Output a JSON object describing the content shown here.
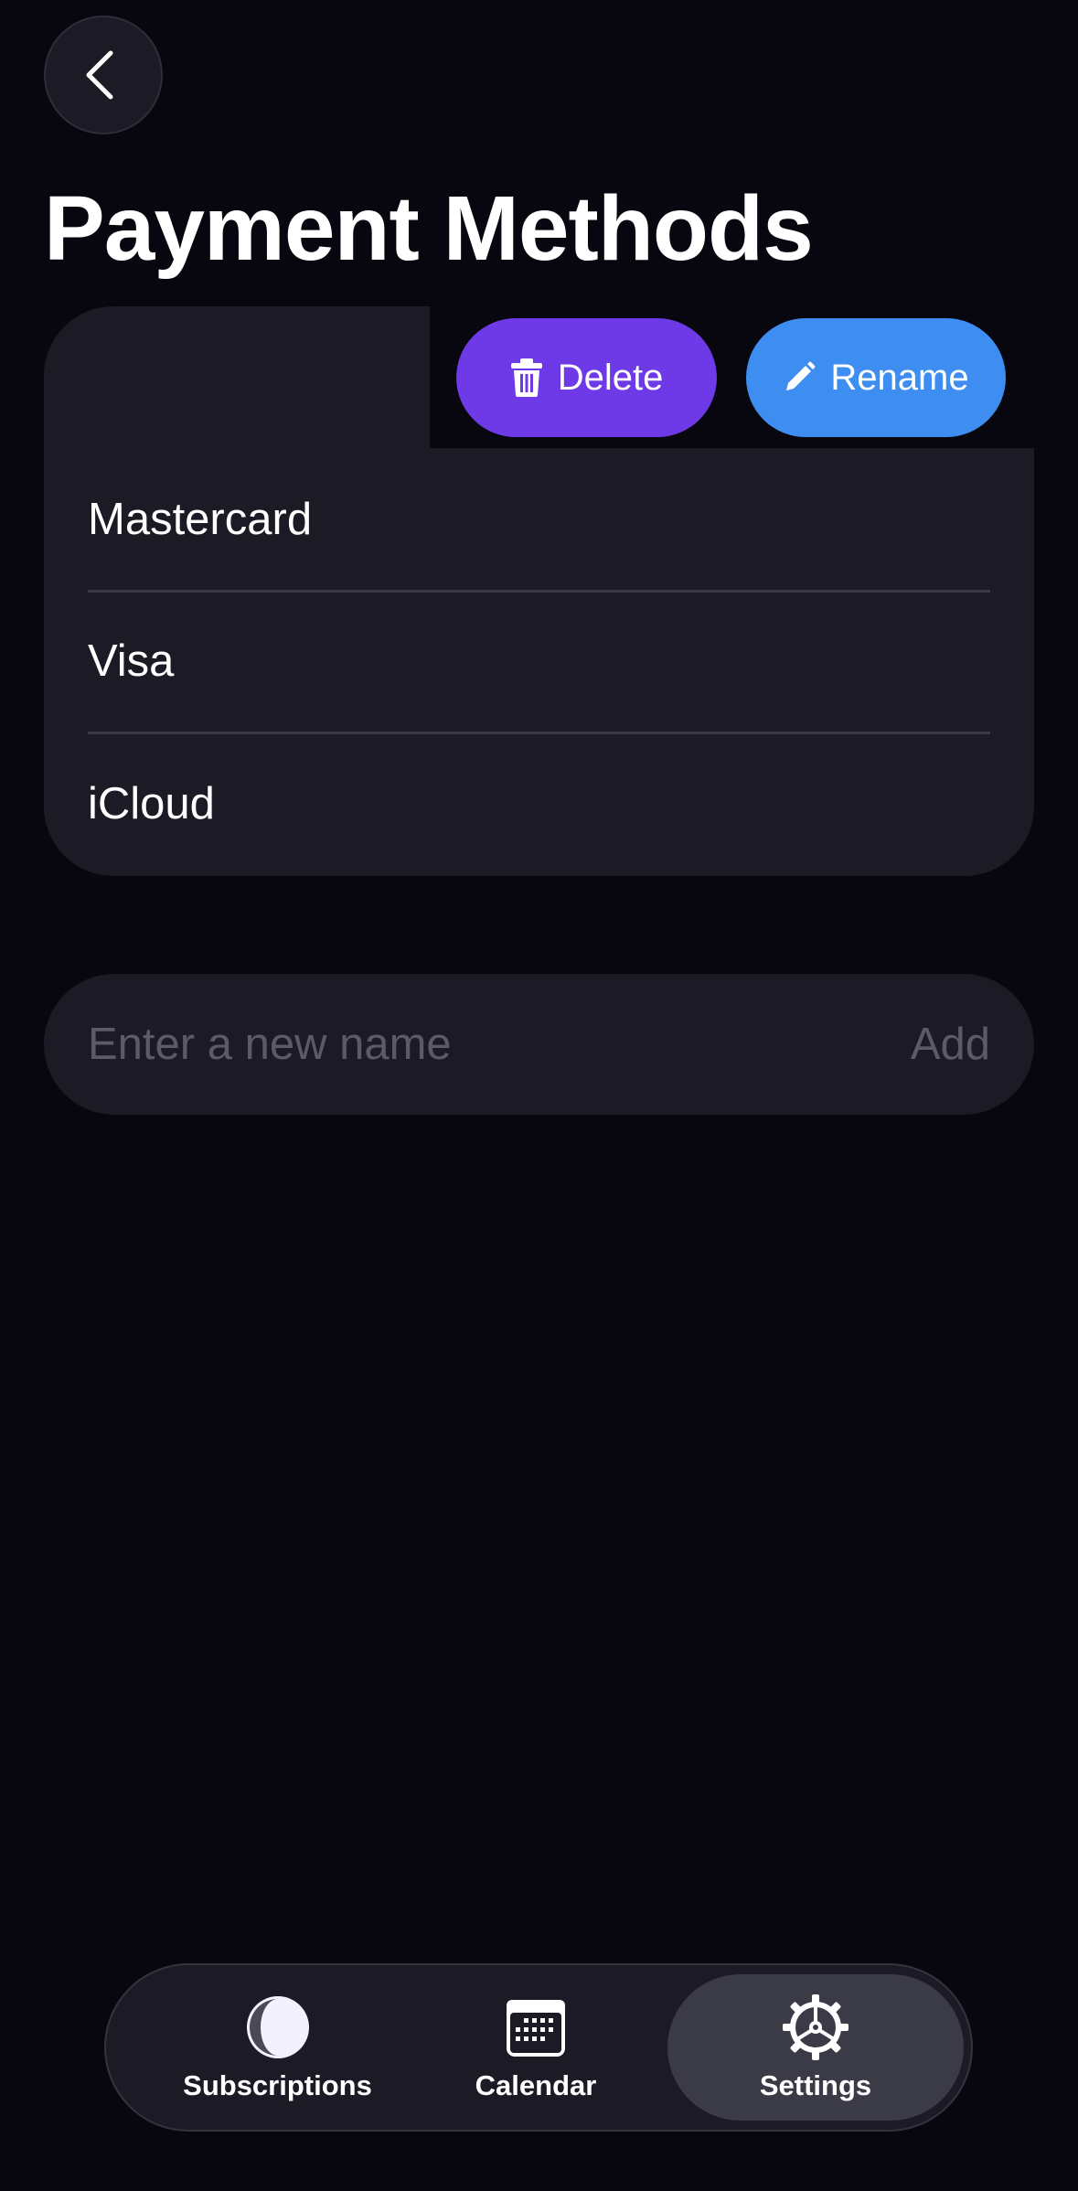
{
  "header": {
    "back_icon": "chevron-left-icon",
    "title": "Payment Methods"
  },
  "row_actions": {
    "delete_label": "Delete",
    "delete_icon": "trash-icon",
    "delete_color": "#6e3ae8",
    "rename_label": "Rename",
    "rename_icon": "pencil-icon",
    "rename_color": "#3d8ef0"
  },
  "payment_methods": [
    {
      "label": "Mastercard"
    },
    {
      "label": "Visa"
    },
    {
      "label": "iCloud"
    }
  ],
  "new_name": {
    "placeholder": "Enter a new name",
    "value": "",
    "add_label": "Add"
  },
  "tab_bar": {
    "tabs": [
      {
        "label": "Subscriptions",
        "icon": "subscriptions-icon",
        "active": false
      },
      {
        "label": "Calendar",
        "icon": "calendar-icon",
        "active": false
      },
      {
        "label": "Settings",
        "icon": "gear-icon",
        "active": true
      }
    ]
  }
}
